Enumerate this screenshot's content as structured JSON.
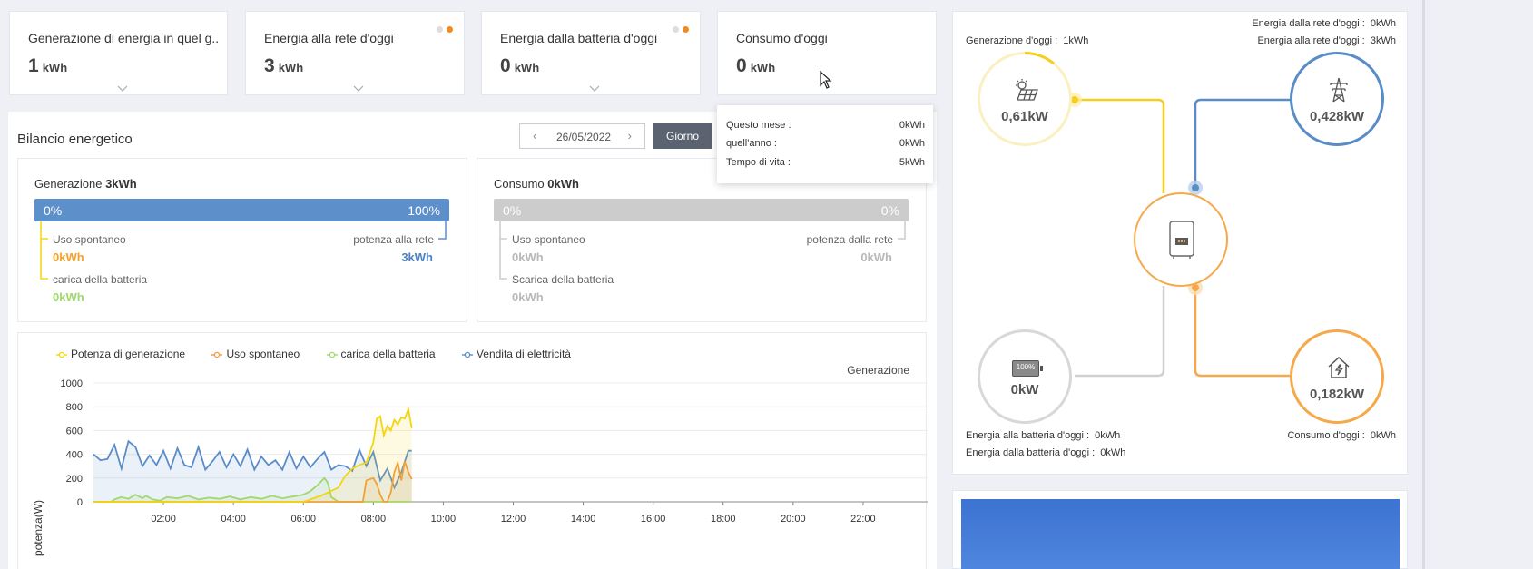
{
  "kpis": [
    {
      "title": "Generazione di energia in quel g...",
      "value": "1",
      "unit": "kWh",
      "dots": false
    },
    {
      "title": "Energia alla rete d'oggi",
      "value": "3",
      "unit": "kWh",
      "dots": true
    },
    {
      "title": "Energia dalla batteria d'oggi",
      "value": "0",
      "unit": "kWh",
      "dots": true
    },
    {
      "title": "Consumo d'oggi",
      "value": "0",
      "unit": "kWh",
      "dots": false
    }
  ],
  "tooltip": {
    "rows": [
      {
        "label": "Questo mese :",
        "value": "0kWh"
      },
      {
        "label": "quell'anno :",
        "value": "0kWh"
      },
      {
        "label": "Tempo di vita :",
        "value": "5kWh"
      }
    ]
  },
  "balance": {
    "title": "Bilancio energetico",
    "date": "26/05/2022",
    "day_button": "Giorno",
    "generation": {
      "label": "Generazione",
      "total": "3kWh",
      "left_pct": "0%",
      "right_pct": "100%",
      "self_use_label": "Uso spontaneo",
      "self_use_value": "0kWh",
      "grid_label": "potenza alla rete",
      "grid_value": "3kWh",
      "battery_label": "carica della batteria",
      "battery_value": "0kWh"
    },
    "consumption": {
      "label": "Consumo",
      "total": "0kWh",
      "left_pct": "0%",
      "right_pct": "0%",
      "self_use_label": "Uso spontaneo",
      "self_use_value": "0kWh",
      "grid_label": "potenza dalla rete",
      "grid_value": "0kWh",
      "battery_label": "Scarica della batteria",
      "battery_value": "0kWh"
    }
  },
  "chart_data": {
    "type": "line",
    "title": "Generazione",
    "xlabel": "",
    "ylabel": "potenza(W)",
    "ylim": [
      0,
      1000
    ],
    "yticks": [
      "0",
      "200",
      "400",
      "600",
      "800",
      "1000"
    ],
    "xticks": [
      "02:00",
      "04:00",
      "06:00",
      "08:00",
      "10:00",
      "12:00",
      "14:00",
      "16:00",
      "18:00",
      "20:00",
      "22:00"
    ],
    "xrange_hours": [
      0,
      24
    ],
    "colors": {
      "generation": "#f5d50e",
      "self_use": "#f29a3c",
      "battery": "#9fd86e",
      "sell": "#5a8cc8"
    },
    "series": [
      {
        "name": "Potenza di generazione",
        "key": "generation",
        "x": [
          0,
          6.0,
          6.5,
          7.0,
          7.2,
          7.4,
          7.6,
          7.8,
          8.0,
          8.1,
          8.2,
          8.3,
          8.4,
          8.5,
          8.6,
          8.7,
          8.8,
          8.9,
          9.0,
          9.1
        ],
        "values": [
          0,
          0,
          50,
          120,
          220,
          280,
          310,
          330,
          500,
          700,
          720,
          560,
          640,
          600,
          690,
          650,
          710,
          700,
          780,
          620
        ]
      },
      {
        "name": "Uso spontaneo",
        "key": "self_use",
        "x": [
          0,
          7.7,
          7.8,
          8.0,
          8.1,
          8.2,
          8.3,
          8.4,
          8.5,
          8.6,
          8.7,
          8.8,
          8.9,
          9.0,
          9.1
        ],
        "values": [
          0,
          0,
          180,
          200,
          150,
          60,
          0,
          0,
          80,
          250,
          330,
          180,
          340,
          250,
          190
        ]
      },
      {
        "name": "carica della batteria",
        "key": "battery",
        "x": [
          0,
          0.5,
          0.6,
          0.8,
          1.0,
          1.2,
          1.4,
          1.5,
          1.7,
          1.9,
          2.1,
          2.4,
          2.7,
          3.0,
          3.3,
          3.6,
          3.9,
          4.2,
          4.5,
          4.8,
          5.1,
          5.4,
          5.7,
          6.0,
          6.2,
          6.4,
          6.6,
          6.7,
          6.8,
          7.0,
          7.5,
          8.0,
          8.5,
          9.1
        ],
        "values": [
          0,
          0,
          20,
          40,
          25,
          60,
          30,
          50,
          20,
          10,
          40,
          30,
          50,
          20,
          35,
          25,
          45,
          20,
          40,
          25,
          50,
          30,
          45,
          60,
          90,
          140,
          200,
          160,
          40,
          0,
          0,
          0,
          0,
          0
        ]
      },
      {
        "name": "Vendita di elettricità",
        "key": "sell",
        "x": [
          0,
          0.2,
          0.4,
          0.6,
          0.8,
          1.0,
          1.2,
          1.4,
          1.6,
          1.8,
          2.0,
          2.2,
          2.4,
          2.6,
          2.8,
          3.0,
          3.2,
          3.4,
          3.6,
          3.8,
          4.0,
          4.2,
          4.4,
          4.6,
          4.8,
          5.0,
          5.2,
          5.4,
          5.6,
          5.8,
          6.0,
          6.2,
          6.4,
          6.6,
          6.8,
          7.0,
          7.2,
          7.4,
          7.6,
          7.8,
          8.0,
          8.2,
          8.4,
          8.6,
          8.8,
          9.0,
          9.1
        ],
        "values": [
          400,
          350,
          360,
          480,
          280,
          510,
          460,
          300,
          390,
          310,
          430,
          280,
          450,
          310,
          290,
          460,
          270,
          340,
          420,
          290,
          400,
          300,
          440,
          270,
          380,
          310,
          350,
          270,
          420,
          280,
          380,
          290,
          360,
          420,
          270,
          310,
          300,
          260,
          440,
          300,
          420,
          180,
          280,
          120,
          250,
          430,
          430
        ]
      }
    ]
  },
  "flow": {
    "gen_today_label": "Generazione d'oggi :",
    "gen_today_value": "1kWh",
    "grid_from_label": "Energia dalla rete d'oggi :",
    "grid_from_value": "0kWh",
    "grid_to_label": "Energia alla rete d'oggi :",
    "grid_to_value": "3kWh",
    "batt_to_label": "Energia alla batteria d'oggi :",
    "batt_to_value": "0kWh",
    "batt_from_label": "Energia dalla batteria d'oggi :",
    "batt_from_value": "0kWh",
    "consumption_label": "Consumo d'oggi :",
    "consumption_value": "0kWh",
    "pv_power": "0,61kW",
    "grid_power": "0,428kW",
    "battery_power": "0kW",
    "battery_level": "100%",
    "load_power": "0,182kW",
    "colors": {
      "pv": "#f5cf1e",
      "grid": "#5a8cc8",
      "battery": "#cfcfcf",
      "load": "#f5a94a",
      "inverter": "#f5a94a"
    }
  }
}
